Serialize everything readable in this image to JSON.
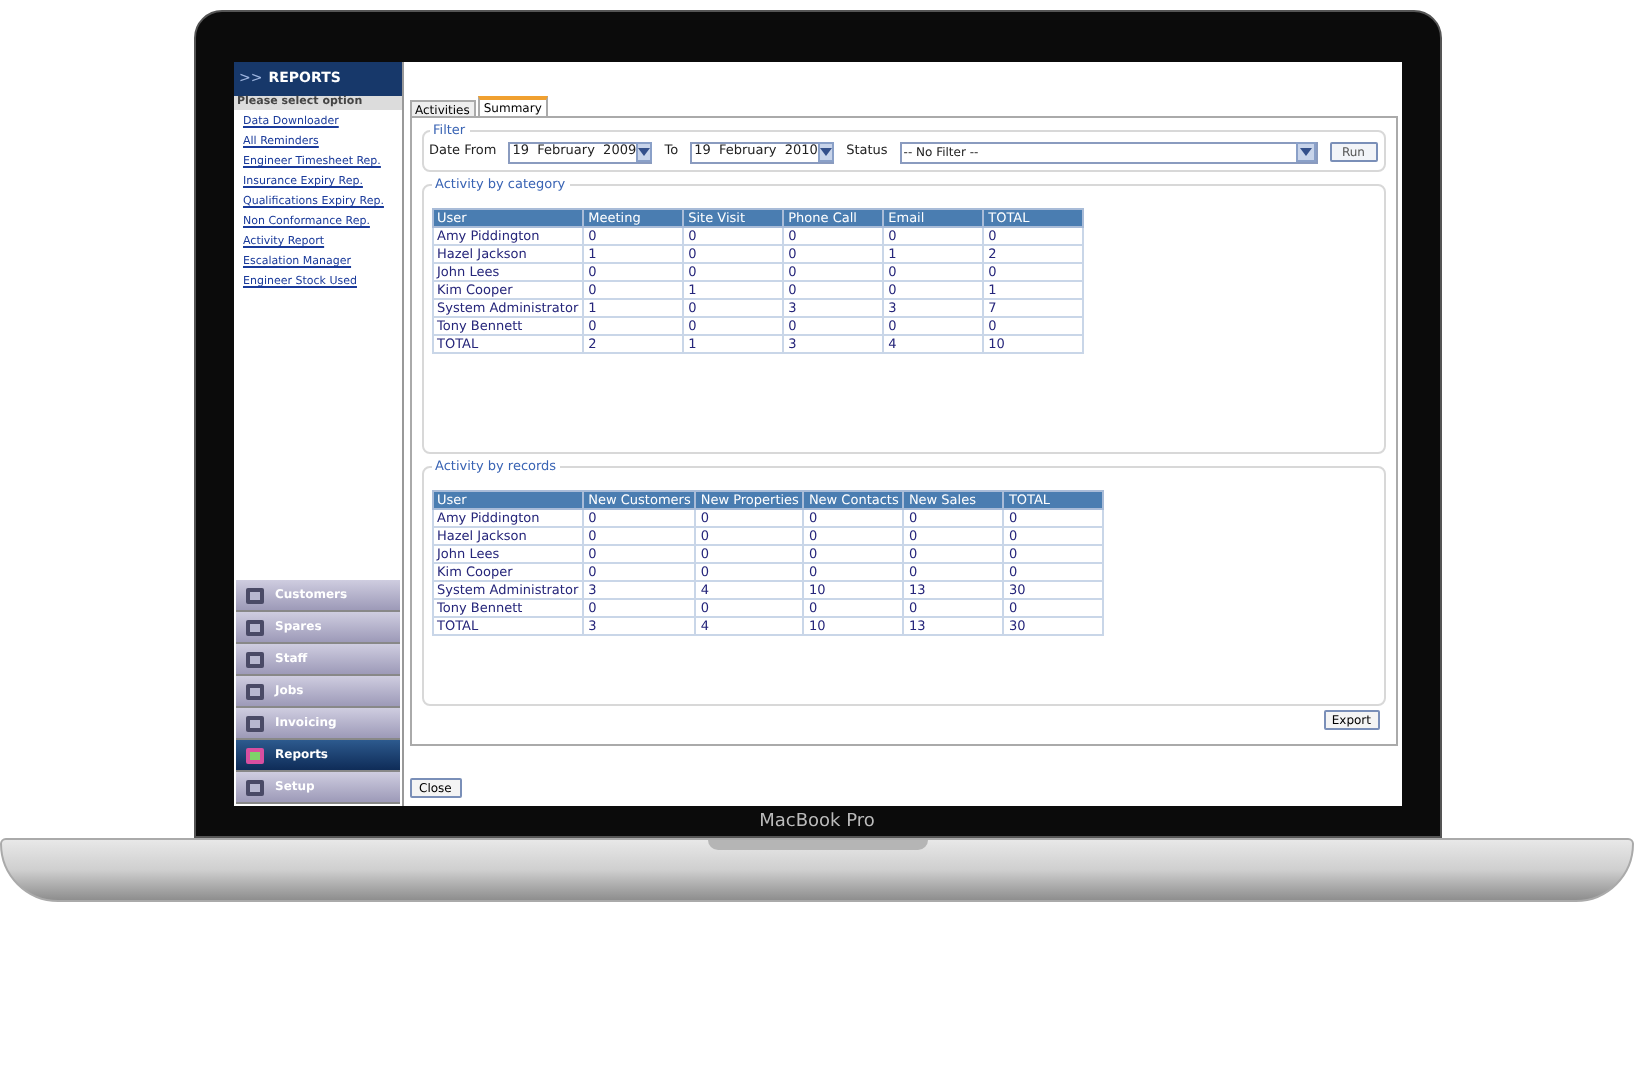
{
  "laptop": {
    "label": "MacBook Pro"
  },
  "sidebar": {
    "arrows": ">>",
    "title": "REPORTS",
    "prompt": "Please select option",
    "links": [
      "Data Downloader",
      "All Reminders",
      "Engineer Timesheet Rep.",
      "Insurance Expiry Rep.",
      "Qualifications Expiry Rep.",
      "Non Conformance Rep.",
      "Activity Report",
      "Escalation Manager",
      "Engineer Stock Used"
    ],
    "nav": [
      {
        "label": "Customers",
        "selected": false
      },
      {
        "label": "Spares",
        "selected": false
      },
      {
        "label": "Staff",
        "selected": false
      },
      {
        "label": "Jobs",
        "selected": false
      },
      {
        "label": "Invoicing",
        "selected": false
      },
      {
        "label": "Reports",
        "selected": true
      },
      {
        "label": "Setup",
        "selected": false
      }
    ]
  },
  "tabs": [
    {
      "label": "Activities",
      "selected": false
    },
    {
      "label": "Summary",
      "selected": true
    }
  ],
  "filter": {
    "legend": "Filter",
    "date_from_label": "Date From",
    "date_from": "19  February  2009",
    "to_label": "To",
    "date_to": "19  February  2010",
    "status_label": "Status",
    "status": "-- No Filter --",
    "run": "Run"
  },
  "tables": [
    {
      "legend": "Activity by category",
      "columns": [
        "User",
        "Meeting",
        "Site Visit",
        "Phone Call",
        "Email",
        "TOTAL"
      ],
      "rows": [
        [
          "Amy Piddington",
          "0",
          "0",
          "0",
          "0",
          "0"
        ],
        [
          "Hazel Jackson",
          "1",
          "0",
          "0",
          "1",
          "2"
        ],
        [
          "John Lees",
          "0",
          "0",
          "0",
          "0",
          "0"
        ],
        [
          "Kim Cooper",
          "0",
          "1",
          "0",
          "0",
          "1"
        ],
        [
          "System Administrator",
          "1",
          "0",
          "3",
          "3",
          "7"
        ],
        [
          "Tony Bennett",
          "0",
          "0",
          "0",
          "0",
          "0"
        ],
        [
          "TOTAL",
          "2",
          "1",
          "3",
          "4",
          "10"
        ]
      ]
    },
    {
      "legend": "Activity by records",
      "columns": [
        "User",
        "New Customers",
        "New Properties",
        "New Contacts",
        "New Sales",
        "TOTAL"
      ],
      "rows": [
        [
          "Amy Piddington",
          "0",
          "0",
          "0",
          "0",
          "0"
        ],
        [
          "Hazel Jackson",
          "0",
          "0",
          "0",
          "0",
          "0"
        ],
        [
          "John Lees",
          "0",
          "0",
          "0",
          "0",
          "0"
        ],
        [
          "Kim Cooper",
          "0",
          "0",
          "0",
          "0",
          "0"
        ],
        [
          "System Administrator",
          "3",
          "4",
          "10",
          "13",
          "30"
        ],
        [
          "Tony Bennett",
          "0",
          "0",
          "0",
          "0",
          "0"
        ],
        [
          "TOTAL",
          "3",
          "4",
          "10",
          "13",
          "30"
        ]
      ]
    }
  ],
  "buttons": {
    "export": "Export",
    "close": "Close"
  }
}
